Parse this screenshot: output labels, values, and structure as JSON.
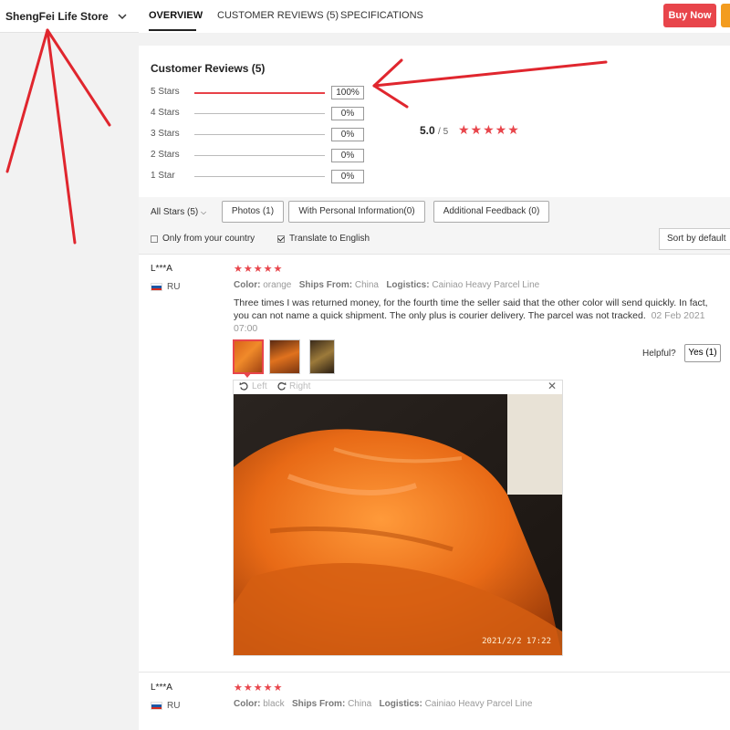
{
  "sidebar": {
    "store_name": "ShengFei Life Store"
  },
  "nav": {
    "tabs": [
      "OVERVIEW",
      "CUSTOMER REVIEWS (5)",
      "SPECIFICATIONS"
    ],
    "buy_now": "Buy Now"
  },
  "reviews_summary": {
    "title": "Customer Reviews (5)",
    "rows": [
      {
        "label": "5 Stars",
        "pct": "100%",
        "fill": 1.0
      },
      {
        "label": "4 Stars",
        "pct": "0%",
        "fill": 0
      },
      {
        "label": "3 Stars",
        "pct": "0%",
        "fill": 0
      },
      {
        "label": "2 Stars",
        "pct": "0%",
        "fill": 0
      },
      {
        "label": "1 Star",
        "pct": "0%",
        "fill": 0
      }
    ],
    "score": "5.0",
    "score_denom": "/ 5",
    "stars": "★★★★★"
  },
  "filters": {
    "all_stars": "All Stars (5)",
    "chips": [
      "Photos (1)",
      "With Personal Information(0)",
      "Additional Feedback (0)"
    ],
    "only_country": "Only from your country",
    "translate": "Translate to English",
    "sort": "Sort by default"
  },
  "reviews": [
    {
      "name": "L***A",
      "country": "RU",
      "stars": "★★★★★",
      "color_label": "Color:",
      "color": "orange",
      "ships_label": "Ships From:",
      "ships": "China",
      "logistics_label": "Logistics:",
      "logistics": "Cainiao Heavy Parcel Line",
      "text": "Three times I was returned money, for the fourth time the seller said that the other color will send quickly. In fact, you can not name a quick shipment. The only plus is courier delivery. The parcel was not tracked.",
      "date": "02 Feb 2021 07:00",
      "helpful_label": "Helpful?",
      "helpful_yes": "Yes (1)",
      "viewer_left": "Left",
      "viewer_right": "Right",
      "photo_stamp": "2021/2/2  17:22"
    },
    {
      "name": "L***A",
      "country": "RU",
      "stars": "★★★★★",
      "color_label": "Color:",
      "color": "black",
      "ships_label": "Ships From:",
      "ships": "China",
      "logistics_label": "Logistics:",
      "logistics": "Cainiao Heavy Parcel Line"
    }
  ],
  "colors": {
    "accent": "#e8454b",
    "buy_now": "#e8454b",
    "cart": "#f39c1f",
    "annotation": "#e0262e"
  }
}
